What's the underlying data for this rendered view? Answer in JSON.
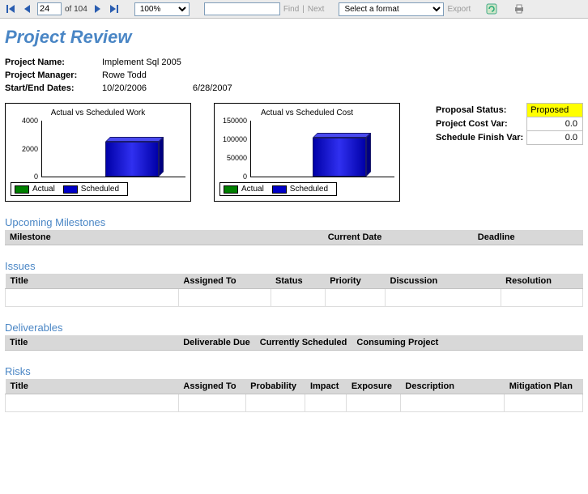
{
  "toolbar": {
    "page_current": "24",
    "page_of": "of 104",
    "zoom": "100%",
    "find_placeholder": "",
    "find_label": "Find",
    "next_label": "Next",
    "format_placeholder": "Select a format",
    "export_label": "Export"
  },
  "title": "Project Review",
  "info": {
    "project_name_label": "Project Name:",
    "project_name": "Implement Sql 2005",
    "manager_label": "Project Manager:",
    "manager": "Rowe Todd",
    "dates_label": "Start/End Dates:",
    "start_date": "10/20/2006",
    "end_date": "6/28/2007"
  },
  "status": {
    "proposal_label": "Proposal Status:",
    "proposal_value": "Proposed",
    "cost_var_label": "Project Cost Var:",
    "cost_var_value": "0.0",
    "finish_var_label": "Schedule Finish Var:",
    "finish_var_value": "0.0"
  },
  "chart_data": [
    {
      "type": "bar",
      "title": "Actual vs Scheduled Work",
      "series": [
        {
          "name": "Actual",
          "values": [
            0
          ],
          "color": "#008000"
        },
        {
          "name": "Scheduled",
          "values": [
            2800
          ],
          "color": "#0000c8"
        }
      ],
      "ylim": [
        0,
        4000
      ],
      "yticks": [
        0,
        2000,
        4000
      ],
      "xlabel": "",
      "ylabel": ""
    },
    {
      "type": "bar",
      "title": "Actual vs Scheduled Cost",
      "series": [
        {
          "name": "Actual",
          "values": [
            0
          ],
          "color": "#008000"
        },
        {
          "name": "Scheduled",
          "values": [
            115000
          ],
          "color": "#0000c8"
        }
      ],
      "ylim": [
        0,
        150000
      ],
      "yticks": [
        0,
        50000,
        100000,
        150000
      ],
      "xlabel": "",
      "ylabel": ""
    }
  ],
  "sections": {
    "milestones": {
      "heading": "Upcoming Milestones",
      "cols": {
        "milestone": "Milestone",
        "current": "Current Date",
        "deadline": "Deadline"
      }
    },
    "issues": {
      "heading": "Issues",
      "cols": {
        "title": "Title",
        "assigned": "Assigned To",
        "status": "Status",
        "priority": "Priority",
        "discussion": "Discussion",
        "resolution": "Resolution"
      }
    },
    "deliverables": {
      "heading": "Deliverables",
      "cols": {
        "title": "Title",
        "due": "Deliverable Due",
        "sched": "Currently Scheduled",
        "consuming": "Consuming Project"
      }
    },
    "risks": {
      "heading": "Risks",
      "cols": {
        "title": "Title",
        "assigned": "Assigned To",
        "prob": "Probability",
        "impact": "Impact",
        "exposure": "Exposure",
        "desc": "Description",
        "mitigation": "Mitigation Plan"
      }
    }
  }
}
